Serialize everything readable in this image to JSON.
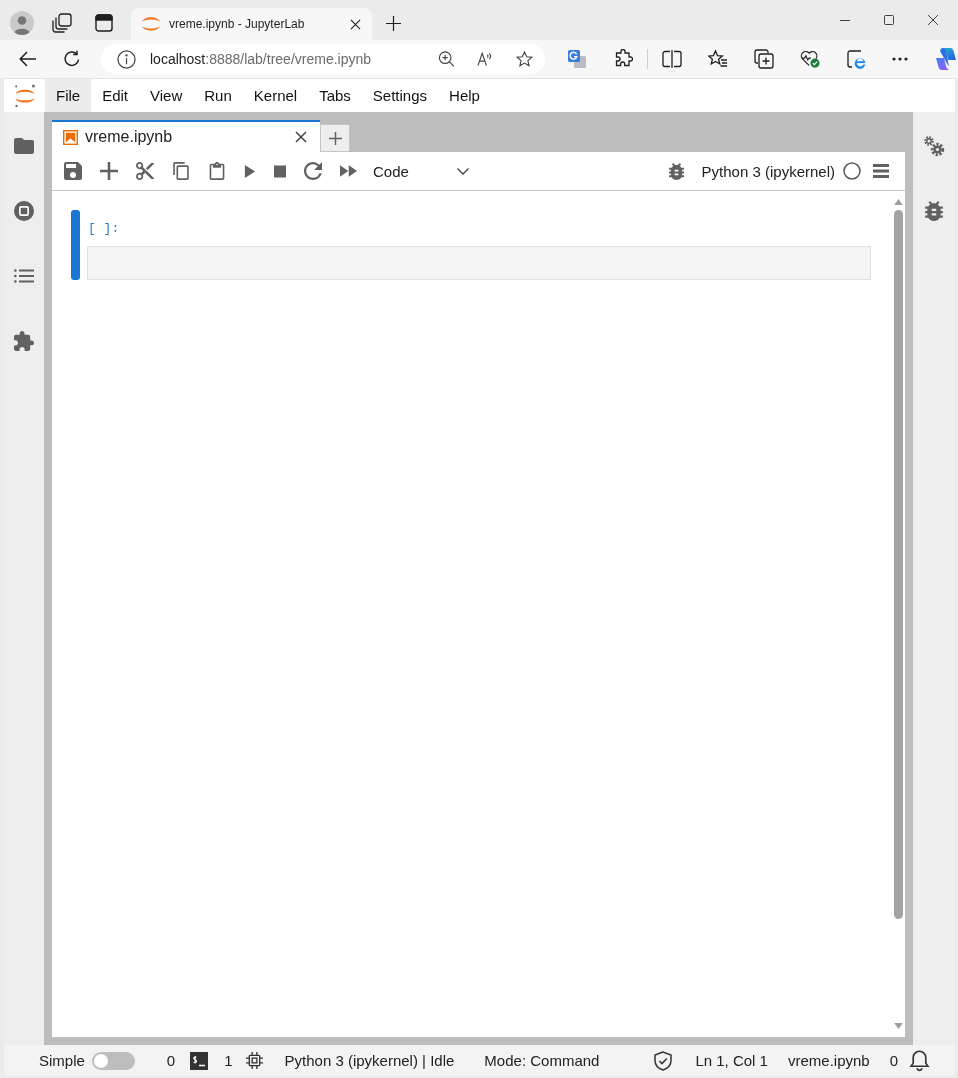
{
  "browser": {
    "tabs": [
      {
        "title": "vreme.ipynb - JupyterLab",
        "selected": true
      }
    ],
    "address": {
      "host": "localhost",
      "path": ":8888/lab/tree/vreme.ipynb"
    }
  },
  "menu_bar": {
    "items": [
      {
        "label": "File",
        "selected": true
      },
      {
        "label": "Edit",
        "selected": false
      },
      {
        "label": "View",
        "selected": false
      },
      {
        "label": "Run",
        "selected": false
      },
      {
        "label": "Kernel",
        "selected": false
      },
      {
        "label": "Tabs",
        "selected": false
      },
      {
        "label": "Settings",
        "selected": false
      },
      {
        "label": "Help",
        "selected": false
      }
    ]
  },
  "document_tabs": [
    {
      "label": "vreme.ipynb",
      "selected": true
    }
  ],
  "toolbar": {
    "cell_type": "Code",
    "kernel_name": "Python 3 (ipykernel)",
    "kernel_busy": false
  },
  "cells": [
    {
      "prompt": "[ ]:",
      "selected": true
    }
  ],
  "status_bar": {
    "simple_mode": {
      "label": "Simple",
      "on": false
    },
    "terminals": "0",
    "kernels": "1",
    "kernel_status": "Python 3 (ipykernel) | Idle",
    "mode": "Mode: Command",
    "cursor": "Ln 1, Col 1",
    "file": "vreme.ipynb",
    "notifications": "0"
  }
}
